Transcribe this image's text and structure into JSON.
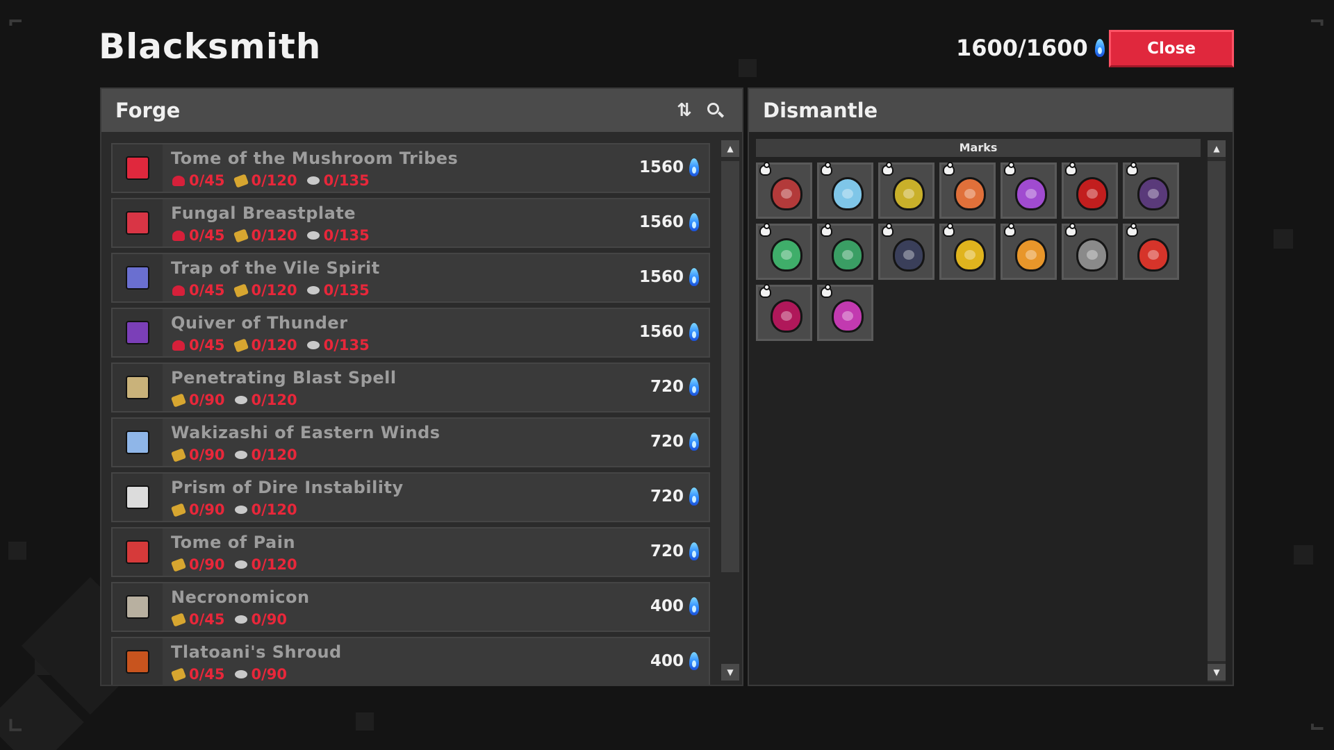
{
  "window": {
    "title": "Blacksmith",
    "currency_value": "1600/1600",
    "close_label": "Close"
  },
  "colors": {
    "accent_close": "#e0283d",
    "material_missing": "#e8273a",
    "essence_flame": "#2e8bff"
  },
  "forge": {
    "title": "Forge",
    "sort_icon": "sort-arrows-icon",
    "search_icon": "search-icon",
    "recipes": [
      {
        "name": "Tome of the Mushroom Tribes",
        "sprite_color": "#e0283d",
        "cost": "1560",
        "materials": [
          {
            "type": "red",
            "icon": "heart-shard-icon",
            "amount": "0/45"
          },
          {
            "type": "gold",
            "icon": "gold-ore-icon",
            "amount": "0/120"
          },
          {
            "type": "silver",
            "icon": "silver-ore-icon",
            "amount": "0/135"
          }
        ]
      },
      {
        "name": "Fungal Breastplate",
        "sprite_color": "#d93545",
        "cost": "1560",
        "materials": [
          {
            "type": "red",
            "icon": "heart-shard-icon",
            "amount": "0/45"
          },
          {
            "type": "gold",
            "icon": "gold-ore-icon",
            "amount": "0/120"
          },
          {
            "type": "silver",
            "icon": "silver-ore-icon",
            "amount": "0/135"
          }
        ]
      },
      {
        "name": "Trap of the Vile Spirit",
        "sprite_color": "#6a6fd0",
        "cost": "1560",
        "materials": [
          {
            "type": "red",
            "icon": "heart-shard-icon",
            "amount": "0/45"
          },
          {
            "type": "gold",
            "icon": "gold-ore-icon",
            "amount": "0/120"
          },
          {
            "type": "silver",
            "icon": "silver-ore-icon",
            "amount": "0/135"
          }
        ]
      },
      {
        "name": "Quiver of Thunder",
        "sprite_color": "#7b3fb8",
        "cost": "1560",
        "materials": [
          {
            "type": "red",
            "icon": "heart-shard-icon",
            "amount": "0/45"
          },
          {
            "type": "gold",
            "icon": "gold-ore-icon",
            "amount": "0/120"
          },
          {
            "type": "silver",
            "icon": "silver-ore-icon",
            "amount": "0/135"
          }
        ]
      },
      {
        "name": "Penetrating Blast Spell",
        "sprite_color": "#c9b27a",
        "cost": "720",
        "materials": [
          {
            "type": "gold",
            "icon": "gold-ore-icon",
            "amount": "0/90"
          },
          {
            "type": "silver",
            "icon": "silver-ore-icon",
            "amount": "0/120"
          }
        ]
      },
      {
        "name": "Wakizashi of Eastern Winds",
        "sprite_color": "#8fb6e8",
        "cost": "720",
        "materials": [
          {
            "type": "gold",
            "icon": "gold-ore-icon",
            "amount": "0/90"
          },
          {
            "type": "silver",
            "icon": "silver-ore-icon",
            "amount": "0/120"
          }
        ]
      },
      {
        "name": "Prism of Dire Instability",
        "sprite_color": "#dcdcdc",
        "cost": "720",
        "materials": [
          {
            "type": "gold",
            "icon": "gold-ore-icon",
            "amount": "0/90"
          },
          {
            "type": "silver",
            "icon": "silver-ore-icon",
            "amount": "0/120"
          }
        ]
      },
      {
        "name": "Tome of Pain",
        "sprite_color": "#d63a3a",
        "cost": "720",
        "materials": [
          {
            "type": "gold",
            "icon": "gold-ore-icon",
            "amount": "0/90"
          },
          {
            "type": "silver",
            "icon": "silver-ore-icon",
            "amount": "0/120"
          }
        ]
      },
      {
        "name": "Necronomicon",
        "sprite_color": "#b8b0a0",
        "cost": "400",
        "materials": [
          {
            "type": "gold",
            "icon": "gold-ore-icon",
            "amount": "0/45"
          },
          {
            "type": "silver",
            "icon": "silver-ore-icon",
            "amount": "0/90"
          }
        ]
      },
      {
        "name": "Tlatoani's Shroud",
        "sprite_color": "#c8541e",
        "cost": "400",
        "materials": [
          {
            "type": "gold",
            "icon": "gold-ore-icon",
            "amount": "0/45"
          },
          {
            "type": "silver",
            "icon": "silver-ore-icon",
            "amount": "0/90"
          }
        ]
      }
    ]
  },
  "dismantle": {
    "title": "Dismantle",
    "section_label": "Marks",
    "marks": [
      {
        "name": "red-mask-mark",
        "color": "#b33a3a"
      },
      {
        "name": "sky-eye-mark",
        "color": "#7fc6e8"
      },
      {
        "name": "green-gold-mark",
        "color": "#c9b02a"
      },
      {
        "name": "blue-orange-mark",
        "color": "#e0703a"
      },
      {
        "name": "rainbow-mark",
        "color": "#a04bd0"
      },
      {
        "name": "crimson-mark",
        "color": "#c21e1e"
      },
      {
        "name": "violet-white-mark",
        "color": "#5a3a7a"
      },
      {
        "name": "green-face-mark",
        "color": "#3fae6a"
      },
      {
        "name": "green-face-mark-2",
        "color": "#3a9e64"
      },
      {
        "name": "dark-hood-mark",
        "color": "#3a3f5a"
      },
      {
        "name": "black-gold-mark",
        "color": "#e0b41e"
      },
      {
        "name": "amber-mark",
        "color": "#e8962a"
      },
      {
        "name": "stone-mark",
        "color": "#8a8a8a"
      },
      {
        "name": "flame-mask-mark",
        "color": "#d6342a"
      },
      {
        "name": "shadow-pink-mark",
        "color": "#b0185a"
      },
      {
        "name": "cosmic-mark",
        "color": "#c23ab0"
      }
    ]
  }
}
